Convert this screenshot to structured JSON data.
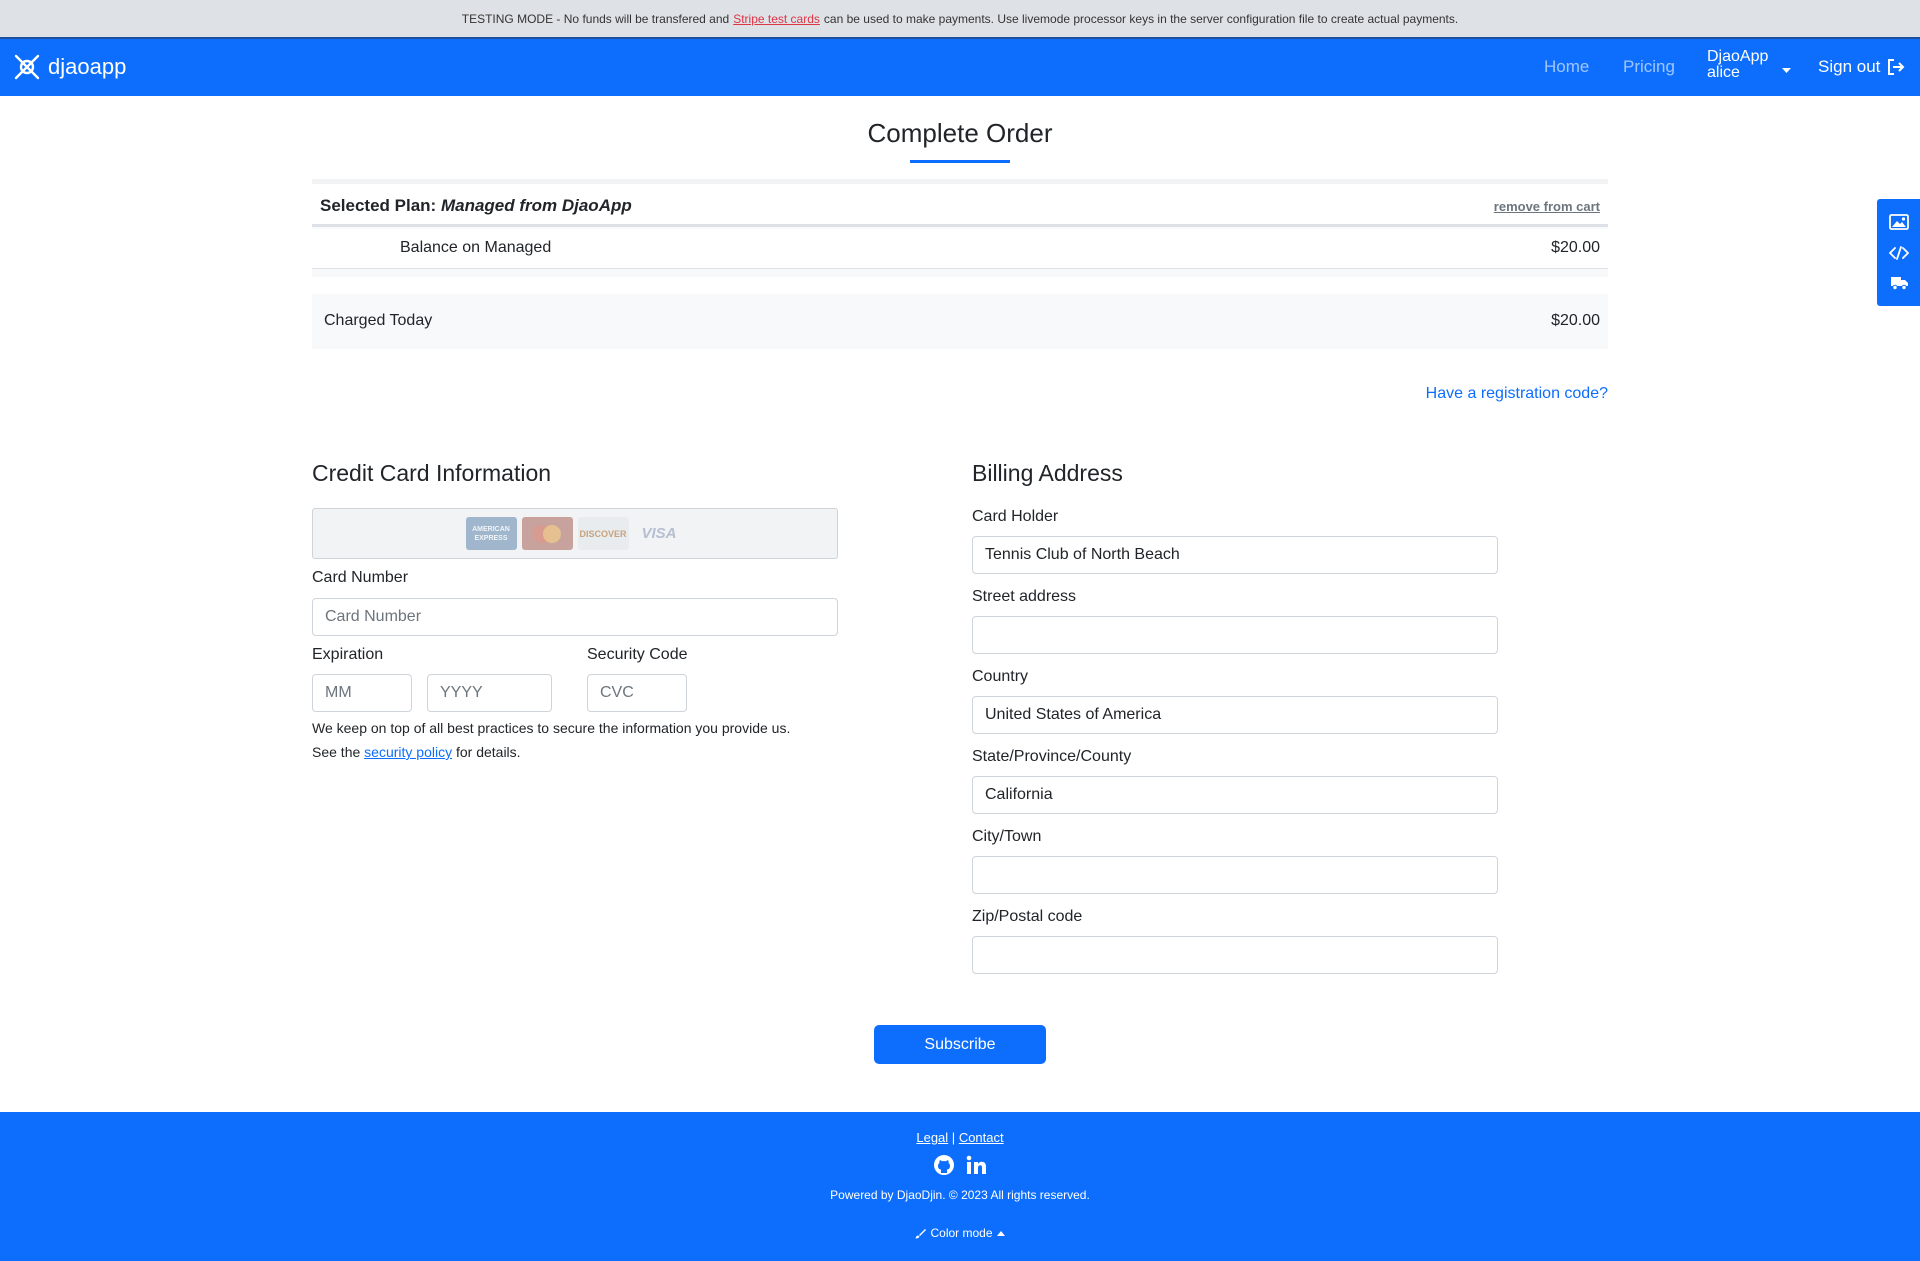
{
  "banner": {
    "text_before": "TESTING MODE - No funds will be transfered and",
    "link": "Stripe test cards",
    "text_after": "can be used to make payments. Use livemode processor keys in the server configuration file to create actual payments."
  },
  "navbar": {
    "brand": "djaoapp",
    "home": "Home",
    "pricing": "Pricing",
    "account_org": "DjaoApp",
    "account_user": "alice",
    "signout": "Sign out"
  },
  "page": {
    "title": "Complete Order"
  },
  "cart": {
    "plan_prefix": "Selected Plan:",
    "plan_name": "Managed from DjaoApp",
    "remove": "remove from cart",
    "line_label": "Balance on Managed",
    "line_amount": "$20.00",
    "charged_label": "Charged Today",
    "charged_amount": "$20.00"
  },
  "registration_link": "Have a registration code?",
  "credit_card": {
    "title": "Credit Card Information",
    "card_logos": [
      "AMERICAN EXPRESS",
      "MasterCard",
      "DISCOVER",
      "VISA"
    ],
    "card_number_label": "Card Number",
    "card_number_placeholder": "Card Number",
    "expiration_label": "Expiration",
    "month_placeholder": "MM",
    "year_placeholder": "YYYY",
    "security_label": "Security Code",
    "cvc_placeholder": "CVC",
    "note_line1": "We keep on top of all best practices to secure the information you provide us.",
    "note_see": "See the",
    "note_link": "security policy",
    "note_end": "for details."
  },
  "billing": {
    "title": "Billing Address",
    "card_holder_label": "Card Holder",
    "card_holder_value": "Tennis Club of North Beach",
    "street_label": "Street address",
    "street_value": "",
    "country_label": "Country",
    "country_value": "United States of America",
    "state_label": "State/Province/County",
    "state_value": "California",
    "city_label": "City/Town",
    "city_value": "",
    "zip_label": "Zip/Postal code",
    "zip_value": ""
  },
  "subscribe": "Subscribe",
  "footer": {
    "legal": "Legal",
    "separator": "|",
    "contact": "Contact",
    "powered": "Powered by DjaoDjin. © 2023 All rights reserved.",
    "color_mode": "Color mode"
  },
  "colors": {
    "primary": "#0d6efd",
    "banner_bg": "#dee2e6",
    "danger": "#dc3545"
  }
}
